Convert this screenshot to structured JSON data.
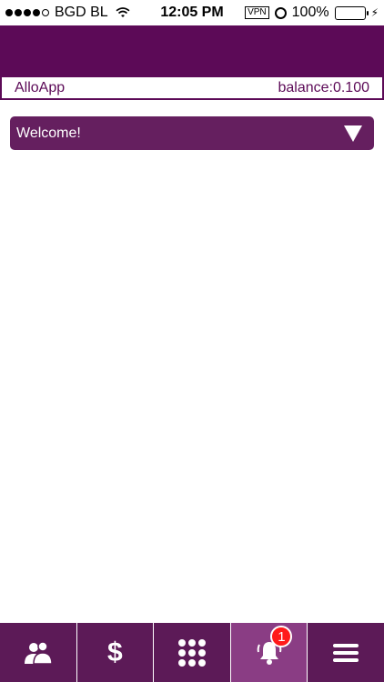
{
  "status_bar": {
    "carrier": "BGD BL",
    "time": "12:05 PM",
    "vpn": "VPN",
    "battery_pct": "100%"
  },
  "app_bar": {
    "app_name": "AlloApp",
    "balance": "balance:0.100"
  },
  "welcome": {
    "label": "Welcome!"
  },
  "tabbar": {
    "tabs": [
      {
        "name": "contacts",
        "icon": "contacts-icon",
        "glyph": "👥"
      },
      {
        "name": "credit",
        "icon": "dollar-icon",
        "glyph": "$"
      },
      {
        "name": "dialpad",
        "icon": "dialpad-icon",
        "glyph": ""
      },
      {
        "name": "notifications",
        "icon": "bell-icon",
        "glyph": "🔔",
        "badge": "1"
      },
      {
        "name": "menu",
        "icon": "menu-icon",
        "glyph": ""
      }
    ]
  },
  "colors": {
    "primary": "#5c0a57",
    "active_tab": "#8a3d84",
    "badge": "#ff1a1a"
  }
}
